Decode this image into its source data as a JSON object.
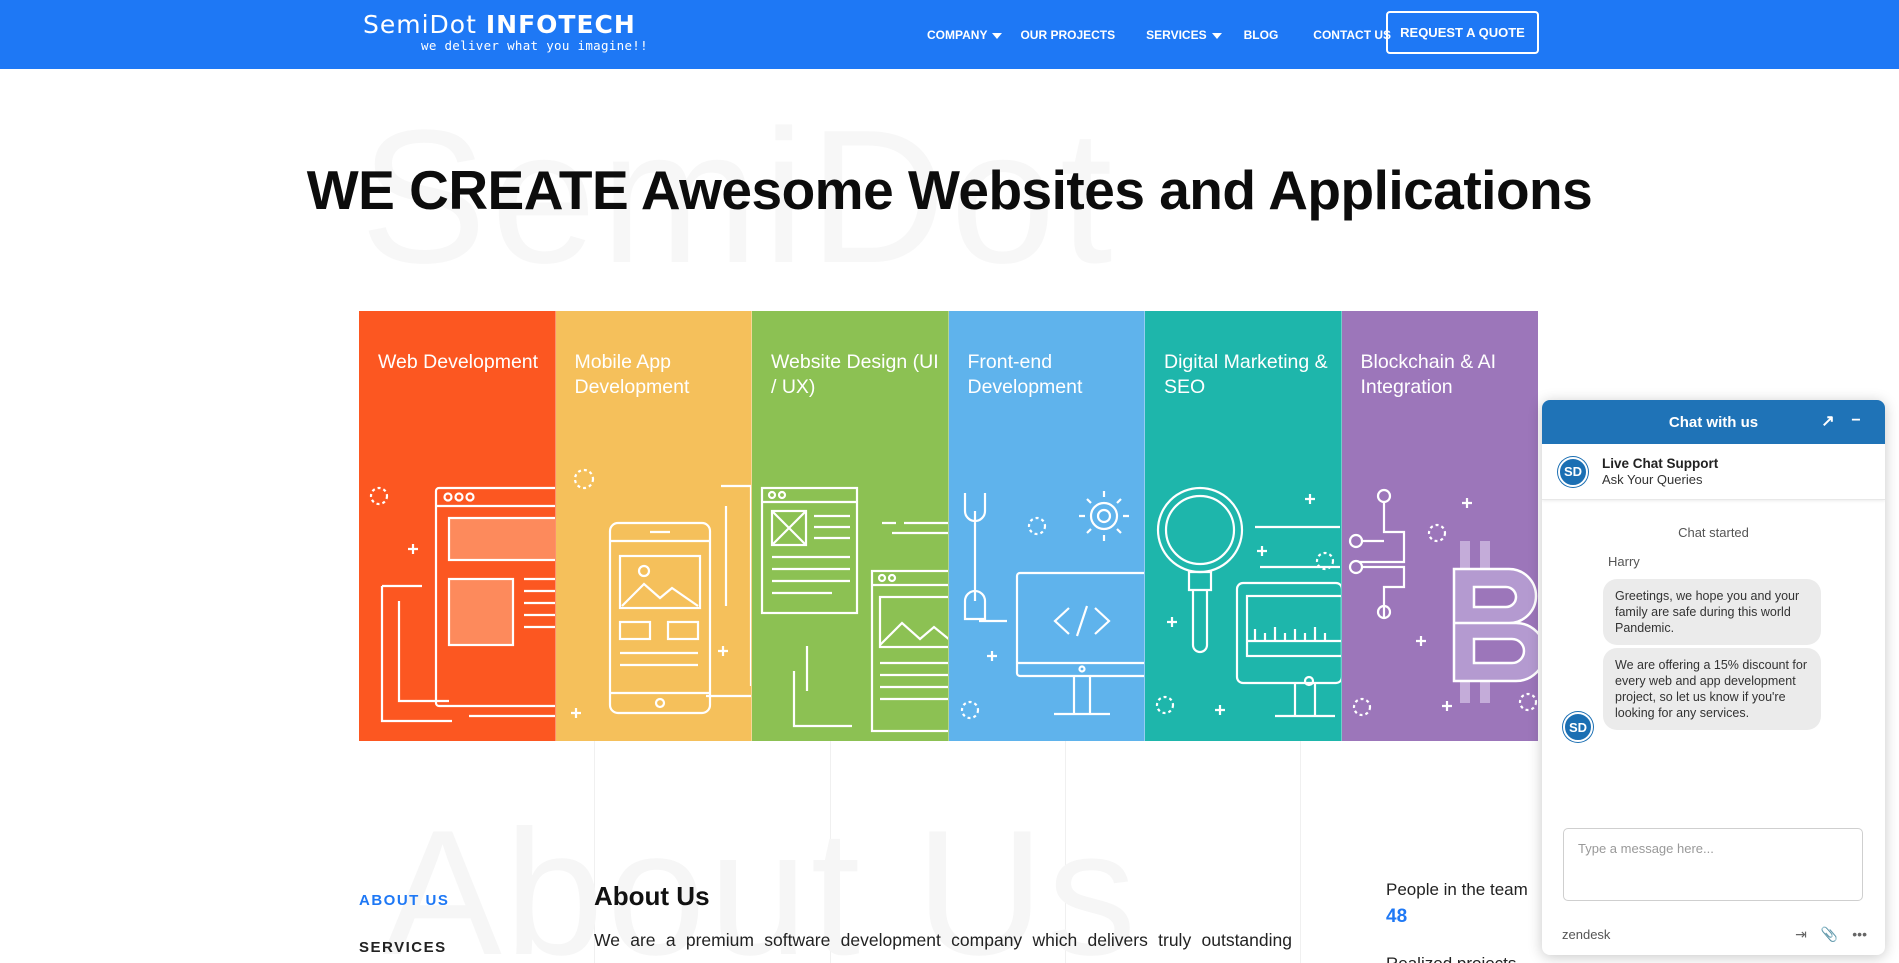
{
  "brand": {
    "name_light": "SemiDot",
    "name_bold": "INFOTECH",
    "tagline": "we deliver what you imagine!!"
  },
  "nav": {
    "items": [
      {
        "label": "COMPANY",
        "has_dropdown": true
      },
      {
        "label": "OUR PROJECTS",
        "has_dropdown": false
      },
      {
        "label": "SERVICES",
        "has_dropdown": true
      },
      {
        "label": "BLOG",
        "has_dropdown": false
      },
      {
        "label": "CONTACT US",
        "has_dropdown": false
      }
    ],
    "cta": "REQUEST A QUOTE"
  },
  "hero": {
    "watermark": "SemiDot",
    "title": "WE CREATE Awesome Websites and Applications"
  },
  "services": [
    {
      "title": "Web Development",
      "color": "#fc5721",
      "icon": "web-development-icon"
    },
    {
      "title": "Mobile App Development",
      "color": "#f5c05b",
      "icon": "mobile-app-icon"
    },
    {
      "title": "Website Design (UI / UX)",
      "color": "#8cc153",
      "icon": "website-design-icon"
    },
    {
      "title": "Front-end Development",
      "color": "#5fb3ec",
      "icon": "front-end-icon"
    },
    {
      "title": "Digital Marketing & SEO",
      "color": "#1eb6ab",
      "icon": "magnifier-icon"
    },
    {
      "title": "Blockchain & AI Integration",
      "color": "#9c76ba",
      "icon": "bitcoin-icon"
    }
  ],
  "about": {
    "watermark": "About Us",
    "side_links": [
      "ABOUT US",
      "SERVICES"
    ],
    "heading": "About Us",
    "text": "We are a premium software development company which delivers truly outstanding",
    "stats": [
      {
        "label": "People in the team",
        "value": "48"
      },
      {
        "label": "Realized projects"
      }
    ]
  },
  "chat": {
    "header": "Chat with us",
    "agent_title": "Live Chat Support",
    "agent_subtitle": "Ask Your Queries",
    "status": "Chat started",
    "agent_name": "Harry",
    "messages": [
      "Greetings, we hope you and your family are safe during this world Pandemic.",
      "We are offering a 15% discount for every web and app development project, so let us know if you're looking for any services."
    ],
    "input_placeholder": "Type a message here...",
    "footer_brand": "zendesk",
    "avatar_text": "SD"
  },
  "colors": {
    "nav_bg": "#1e78f5",
    "accent": "#1e78f5",
    "chat_header": "#1f73b7"
  }
}
